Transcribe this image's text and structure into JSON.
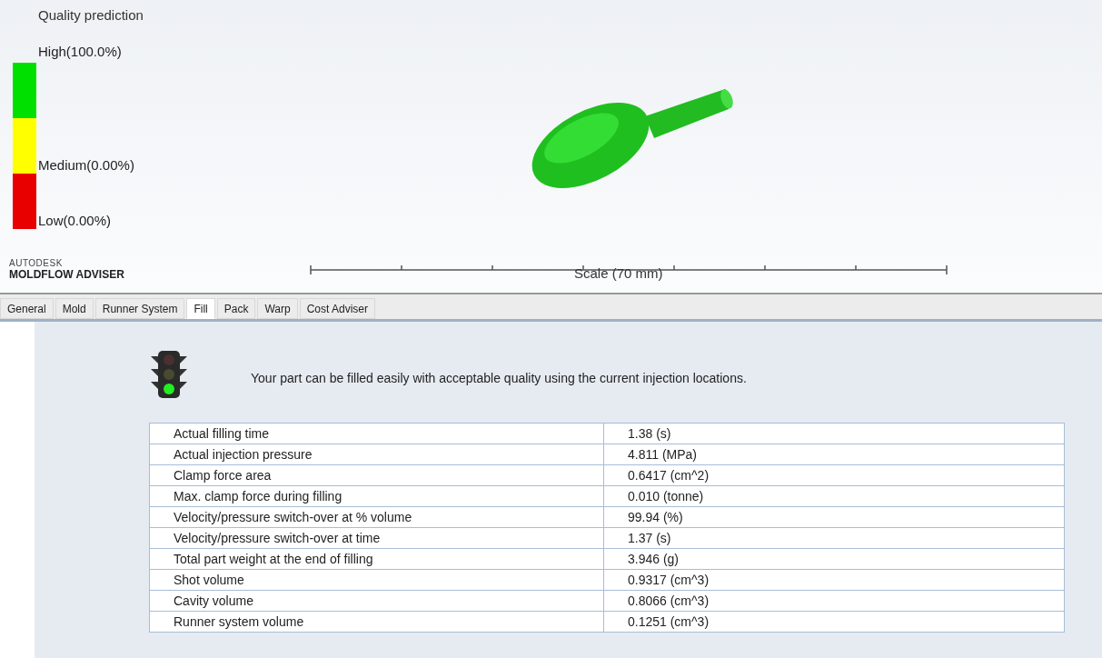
{
  "viewport": {
    "legend_title": "Quality prediction",
    "legend": [
      {
        "label": "High(100.0%)",
        "color": "#00e000"
      },
      {
        "label": "Medium(0.00%)",
        "color": "#ffff00"
      },
      {
        "label": "Low(0.00%)",
        "color": "#e80000"
      }
    ],
    "brand_top": "AUTODESK",
    "brand_bottom": "MOLDFLOW ADVISER",
    "scale_label": "Scale (70 mm)"
  },
  "tabs": [
    {
      "label": "General",
      "selected": false
    },
    {
      "label": "Mold",
      "selected": false
    },
    {
      "label": "Runner System",
      "selected": false
    },
    {
      "label": "Fill",
      "selected": true
    },
    {
      "label": "Pack",
      "selected": false
    },
    {
      "label": "Warp",
      "selected": false
    },
    {
      "label": "Cost Adviser",
      "selected": false
    }
  ],
  "message": "Your part can be filled easily with acceptable quality using the current injection locations.",
  "table": {
    "rows": [
      [
        "Actual filling time",
        "1.38 (s)"
      ],
      [
        "Actual injection pressure",
        "4.811 (MPa)"
      ],
      [
        "Clamp force area",
        "0.6417 (cm^2)"
      ],
      [
        "Max. clamp force during filling",
        "0.010 (tonne)"
      ],
      [
        "Velocity/pressure switch-over at % volume",
        "99.94 (%)"
      ],
      [
        "Velocity/pressure switch-over at time",
        "1.37 (s)"
      ],
      [
        "Total part weight at the end of filling",
        "3.946 (g)"
      ],
      [
        "Shot volume",
        "0.9317 (cm^3)"
      ],
      [
        "Cavity volume",
        "0.8066 (cm^3)"
      ],
      [
        "Runner system volume",
        "0.1251 (cm^3)"
      ]
    ]
  }
}
